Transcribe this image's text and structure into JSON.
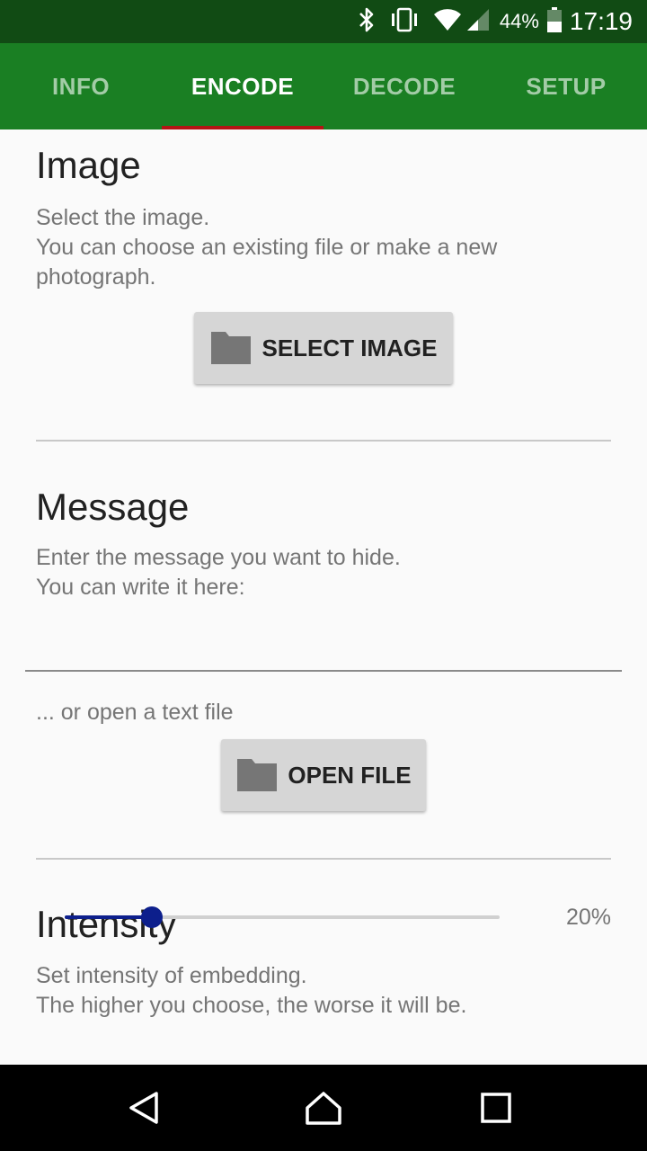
{
  "status_bar": {
    "battery_percent": "44%",
    "time": "17:19",
    "icons": [
      "bluetooth-icon",
      "vibrate-icon",
      "wifi-icon",
      "cell-signal-icon",
      "battery-icon"
    ]
  },
  "tabs": [
    {
      "label": "INFO",
      "active": false
    },
    {
      "label": "ENCODE",
      "active": true
    },
    {
      "label": "DECODE",
      "active": false
    },
    {
      "label": "SETUP",
      "active": false
    }
  ],
  "image_section": {
    "title": "Image",
    "desc_line1": "Select the image.",
    "desc_line2": "You can choose an existing file or make a new",
    "desc_line3": "photograph.",
    "button_label": "SELECT IMAGE",
    "button_icon": "folder-icon"
  },
  "message_section": {
    "title": "Message",
    "desc_line1": "Enter the message you want to hide.",
    "desc_line2": "You can write it here:",
    "input_value": "",
    "alt_text": "... or open a text file",
    "button_label": "OPEN FILE",
    "button_icon": "folder-icon"
  },
  "intensity_section": {
    "title": "Intensity",
    "desc_line1": "Set intensity of embedding.",
    "desc_line2": "The higher you choose, the worse it will be.",
    "value_percent": 20,
    "value_label": "20%"
  },
  "colors": {
    "status_bar": "#114b14",
    "tab_bar": "#1a7f23",
    "tab_indicator": "#b51515",
    "slider_accent": "#0d1f8c"
  },
  "nav_bar": {
    "buttons": [
      "back-icon",
      "home-icon",
      "recents-icon"
    ]
  }
}
